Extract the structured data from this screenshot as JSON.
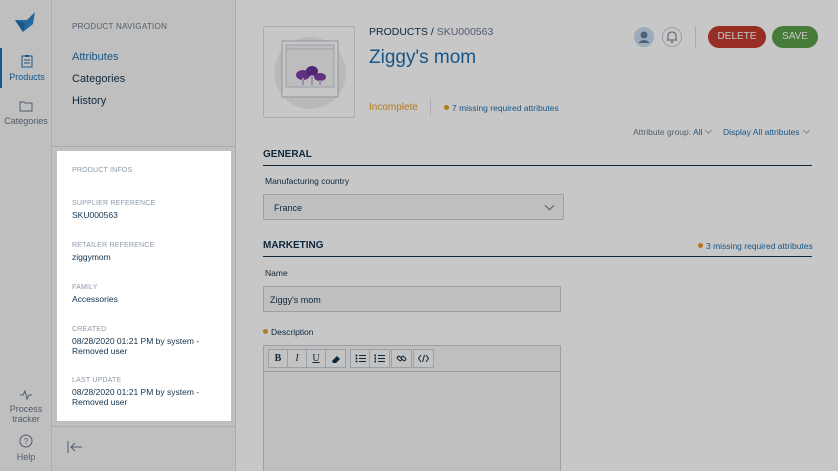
{
  "rail": {
    "items": [
      {
        "label": "Products",
        "icon": "clipboard-icon",
        "active": true
      },
      {
        "label": "Categories",
        "icon": "folder-icon",
        "active": false
      },
      {
        "label": "Process tracker",
        "icon": "pulse-icon",
        "active": false
      },
      {
        "label": "Help",
        "icon": "question-icon",
        "active": false
      }
    ]
  },
  "product_nav": {
    "title": "PRODUCT NAVIGATION",
    "links": [
      "Attributes",
      "Categories",
      "History"
    ]
  },
  "product_infos": {
    "title": "PRODUCT INFOS",
    "fields": [
      {
        "label": "SUPPLIER REFERENCE",
        "value": "SKU000563"
      },
      {
        "label": "RETAILER REFERENCE",
        "value": "ziggymom"
      },
      {
        "label": "FAMILY",
        "value": "Accessories"
      },
      {
        "label": "CREATED",
        "value": "08/28/2020 01:21 PM by system - Removed user"
      },
      {
        "label": "LAST UPDATE",
        "value": "08/28/2020 01:21 PM by system - Removed user"
      }
    ]
  },
  "header": {
    "breadcrumb_root": "PRODUCTS",
    "breadcrumb_sep": " / ",
    "breadcrumb_sku": "SKU000563",
    "title": "Ziggy's mom",
    "status": "Incomplete",
    "missing": "7 missing required attributes",
    "delete_label": "DELETE",
    "save_label": "SAVE"
  },
  "filters": {
    "attr_group_label": "Attribute group:",
    "attr_group_value": "All",
    "display_label": "Display All attributes"
  },
  "sections": {
    "general": {
      "title": "GENERAL",
      "country_label": "Manufacturing country",
      "country_value": "France"
    },
    "marketing": {
      "title": "MARKETING",
      "missing": "3 missing required attributes",
      "name_label": "Name",
      "name_value": "Ziggy's mom",
      "description_label": "Description"
    }
  },
  "colors": {
    "accent": "#1e6fae",
    "warning": "#e69b2b",
    "delete": "#c23b2e",
    "save": "#5b9e4a"
  }
}
